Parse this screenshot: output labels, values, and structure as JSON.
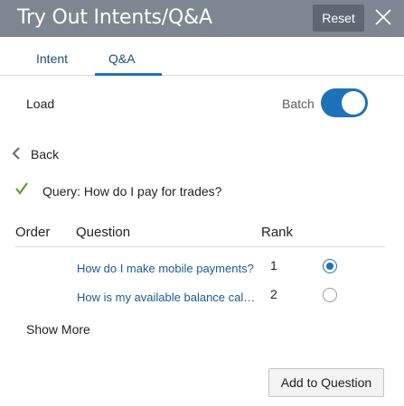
{
  "header": {
    "title": "Try Out Intents/Q&A",
    "reset_label": "Reset",
    "close_icon": "close-icon"
  },
  "tabs": [
    {
      "label": "Intent",
      "selected": false
    },
    {
      "label": "Q&A",
      "selected": true
    }
  ],
  "controls": {
    "load_label": "Load",
    "batch_label": "Batch",
    "batch_enabled": true
  },
  "back": {
    "label": "Back",
    "icon": "chevron-left-icon"
  },
  "query": {
    "text": "Query: How do I pay for trades?",
    "icon": "checkmark-icon"
  },
  "table": {
    "columns": [
      "Order",
      "Question",
      "Rank"
    ],
    "rows": [
      {
        "order": "",
        "question": "How do I make mobile payments?",
        "rank": "1",
        "selected": true
      },
      {
        "order": "",
        "question": "How is my available balance calculated?",
        "rank": "2",
        "selected": false
      }
    ]
  },
  "show_more_label": "Show More",
  "add_button_label": "Add to Question",
  "colors": {
    "header_bg": "#7d8791",
    "accent": "#1e72b7",
    "link": "#1d5a8e",
    "check_green": "#5a9e2f"
  }
}
